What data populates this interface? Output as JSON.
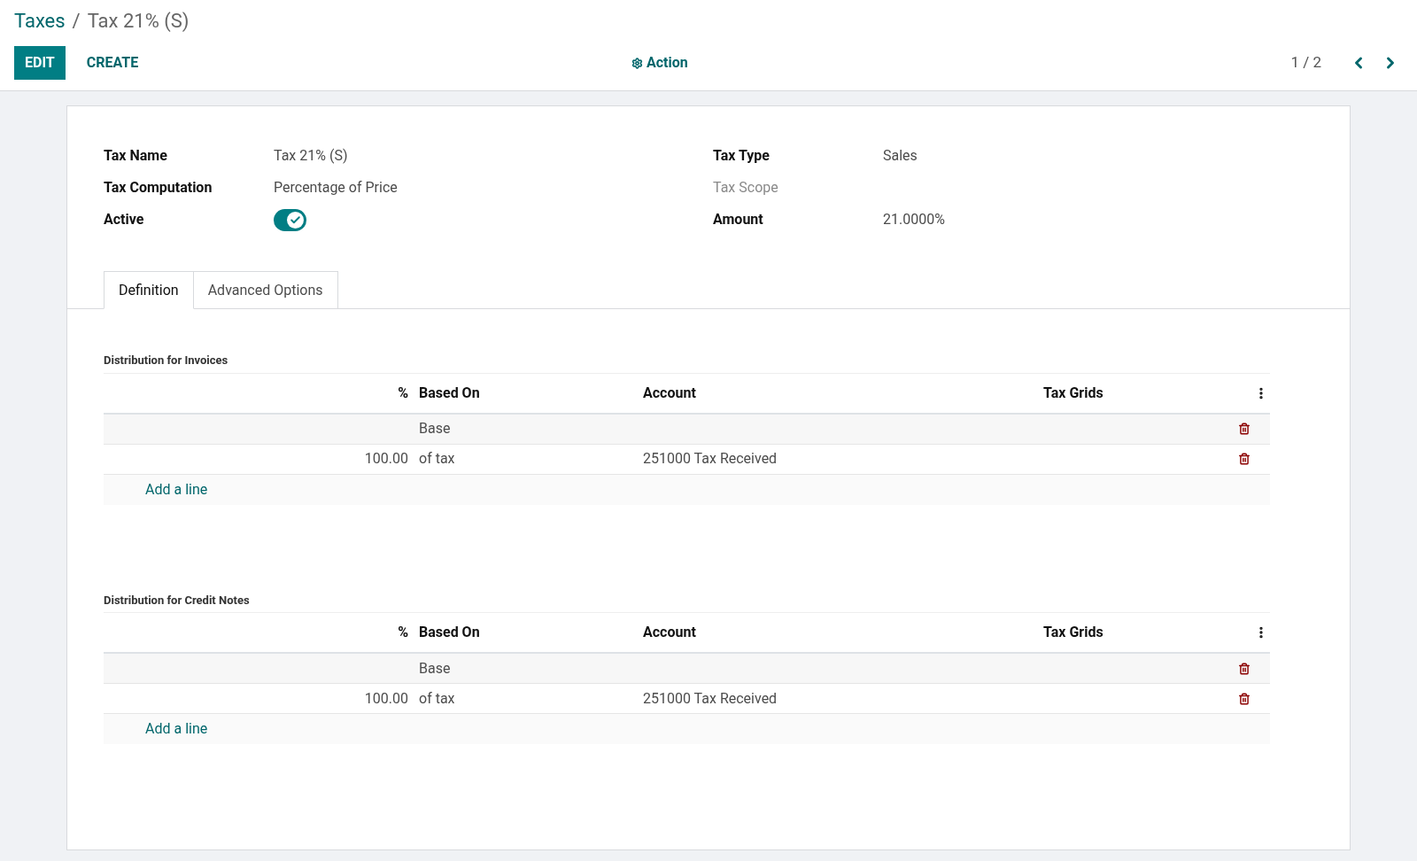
{
  "breadcrumb": {
    "parent": "Taxes",
    "separator": "/",
    "current": "Tax 21% (S)"
  },
  "buttons": {
    "edit": "EDIT",
    "create": "CREATE",
    "action": "Action"
  },
  "pager": "1 / 2",
  "fields_left": [
    {
      "kind": "text",
      "label": "Tax Name",
      "value": "Tax 21% (S)"
    },
    {
      "kind": "text",
      "label": "Tax Computation",
      "value": "Percentage of Price"
    },
    {
      "kind": "toggle",
      "label": "Active",
      "on": true
    }
  ],
  "fields_right": [
    {
      "label": "Tax Type",
      "value": "Sales",
      "muted": false
    },
    {
      "label": "Tax Scope",
      "muted": true
    },
    {
      "label": "Amount",
      "value": "21.0000%",
      "muted": false
    }
  ],
  "tabs": [
    {
      "label": "Definition",
      "selected": true
    },
    {
      "label": "Advanced Options",
      "selected": false
    }
  ],
  "sections": [
    {
      "title": "Distribution for Invoices",
      "columns": [
        "%",
        "Based On",
        "Account",
        "Tax Grids"
      ],
      "rows": [
        {
          "based_on": "Base"
        },
        {
          "percent": "100.00",
          "based_on": "of tax",
          "account": "251000 Tax Received"
        }
      ],
      "add_line": "Add a line"
    },
    {
      "title": "Distribution for Credit Notes",
      "columns": [
        "%",
        "Based On",
        "Account",
        "Tax Grids"
      ],
      "rows": [
        {
          "based_on": "Base"
        },
        {
          "percent": "100.00",
          "based_on": "of tax",
          "account": "251000 Tax Received"
        }
      ],
      "add_line": "Add a line"
    }
  ]
}
